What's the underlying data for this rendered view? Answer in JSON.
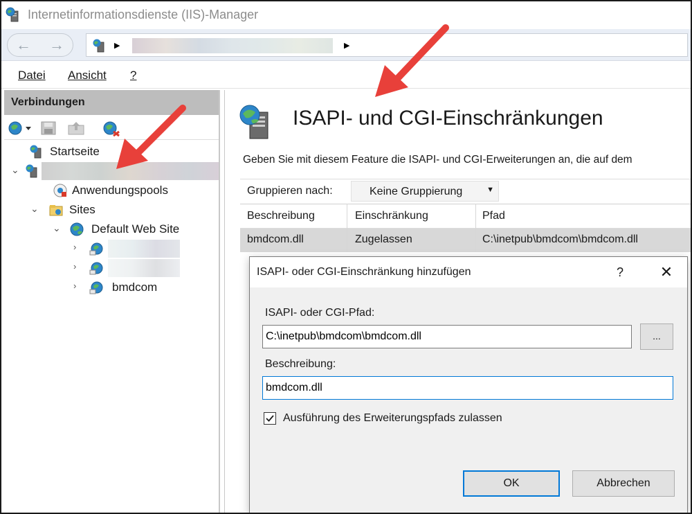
{
  "window": {
    "title": "Internetinformationsdienste (IIS)-Manager"
  },
  "menu": {
    "items": [
      "Datei",
      "Ansicht",
      "?"
    ]
  },
  "connections": {
    "header": "Verbindungen",
    "tree": {
      "start": "Startseite",
      "app_pools": "Anwendungspools",
      "sites": "Sites",
      "default_site": "Default Web Site",
      "bmdcom": "bmdcom"
    }
  },
  "feature": {
    "title": "ISAPI- und CGI-Einschränkungen",
    "description": "Geben Sie mit diesem Feature die ISAPI- und CGI-Erweiterungen an, die auf dem",
    "group_label": "Gruppieren nach:",
    "group_value": "Keine Gruppierung",
    "columns": [
      "Beschreibung",
      "Einschränkung",
      "Pfad"
    ],
    "rows": [
      {
        "description": "bmdcom.dll",
        "restriction": "Zugelassen",
        "path": "C:\\inetpub\\bmdcom\\bmdcom.dll"
      }
    ]
  },
  "dialog": {
    "title": "ISAPI- oder CGI-Einschränkung hinzufügen",
    "help": "?",
    "close": "✕",
    "path_label": "ISAPI- oder CGI-Pfad:",
    "path_value": "C:\\inetpub\\bmdcom\\bmdcom.dll",
    "browse": "...",
    "desc_label": "Beschreibung:",
    "desc_value": "bmdcom.dll",
    "allow_label": "Ausführung des Erweiterungspfads zulassen",
    "allow_checked": true,
    "ok": "OK",
    "cancel": "Abbrechen"
  },
  "colors": {
    "accent": "#0078d7",
    "arrow": "#e8403a",
    "header_gray": "#bdbdbd"
  }
}
